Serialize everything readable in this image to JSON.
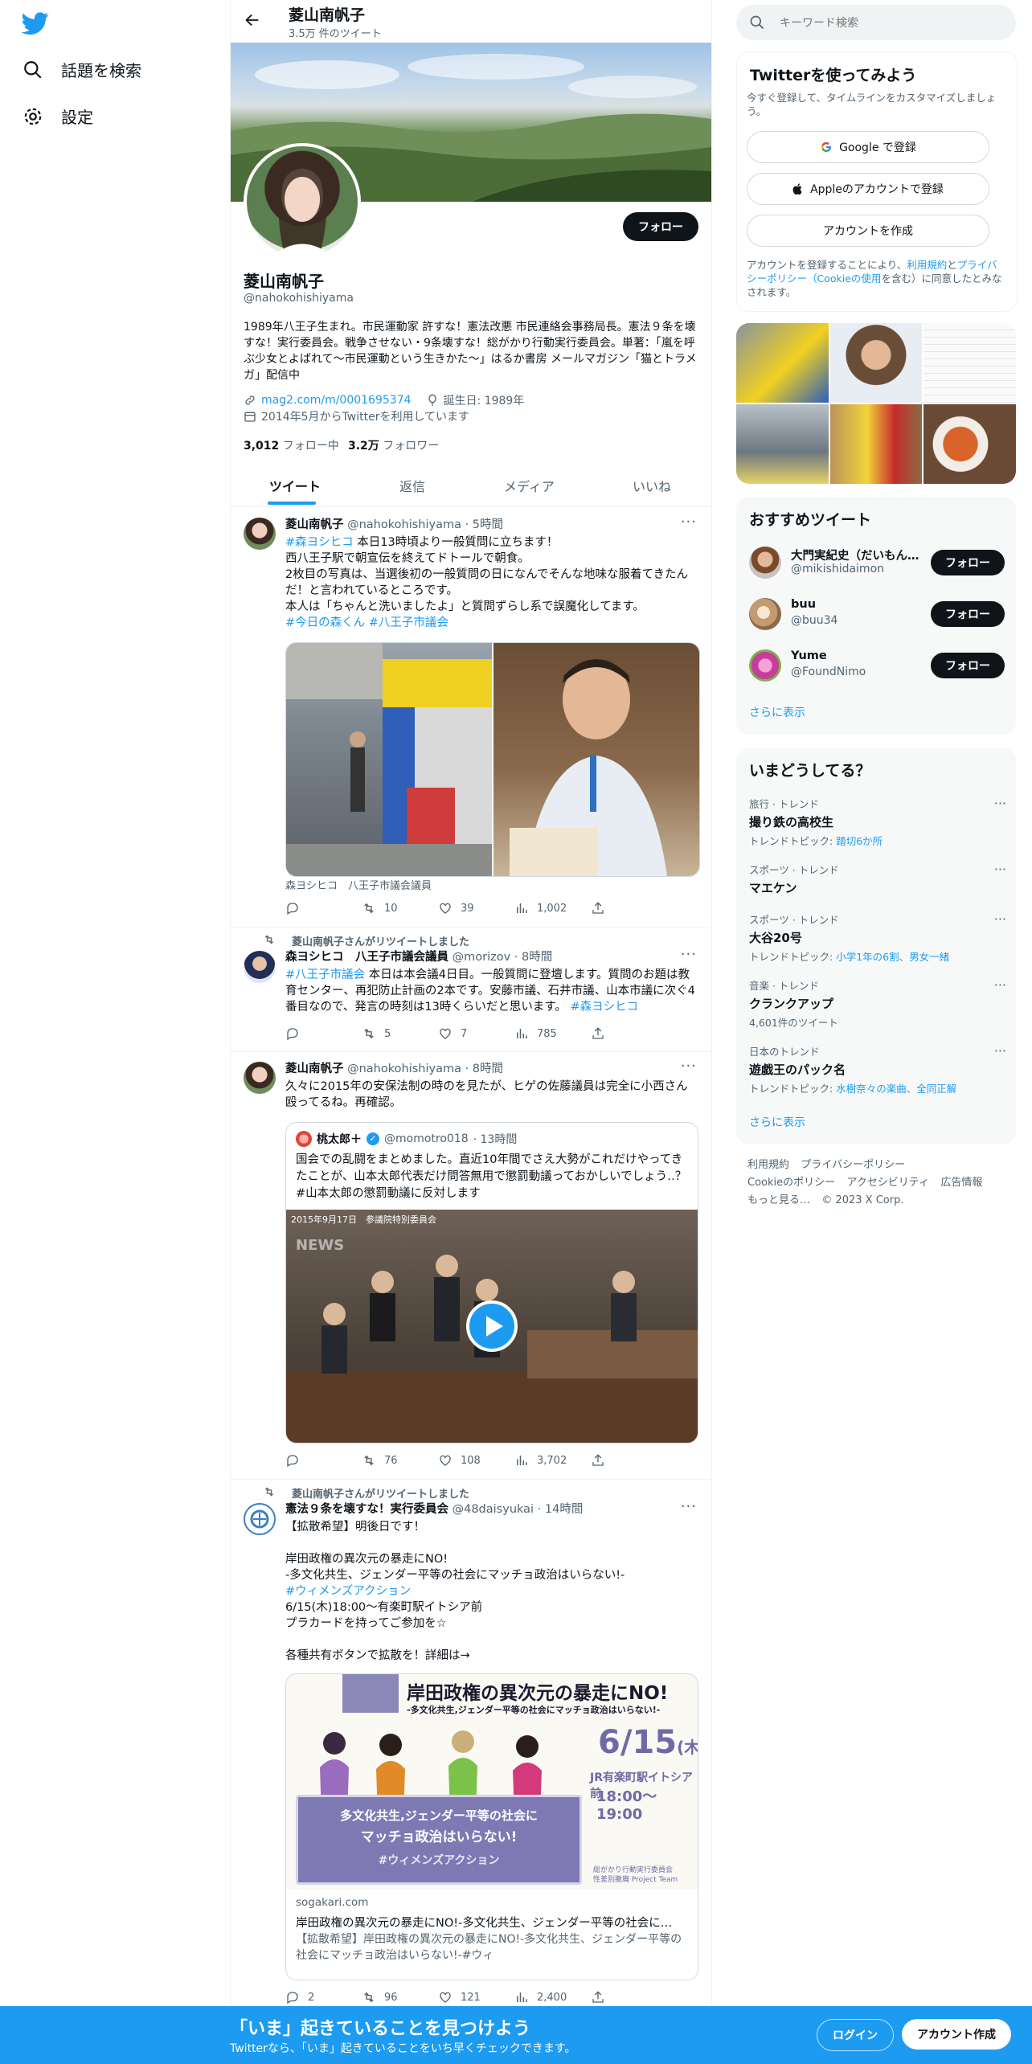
{
  "nav": {
    "explore_label": "話題を検索",
    "settings_label": "設定"
  },
  "profile": {
    "header_name": "菱山南帆子",
    "header_count": "3.5万 件のツイート",
    "name": "菱山南帆子",
    "handle": "@nahokohishiyama",
    "follow_label": "フォロー",
    "bio": "1989年八王子生まれ。市民運動家 許すな！憲法改悪 市民連絡会事務局長。憲法９条を壊すな！実行委員会。戦争させない・9条壊すな！総がかり行動実行委員会。単著：「嵐を呼ぶ少女とよばれて〜市民運動という生きかた〜」はるか書房 メールマガジン「猫とトラメガ」配信中",
    "link": "mag2.com/m/0001695374",
    "birth": "誕生日: 1989年",
    "joined": "2014年5月からTwitterを利用しています",
    "following_count": "3,012",
    "following_label": "フォロー中",
    "followers_count": "3.2万",
    "followers_label": "フォロワー"
  },
  "tabs": [
    "ツイート",
    "返信",
    "メディア",
    "いいね"
  ],
  "tweets": [
    {
      "name": "菱山南帆子",
      "handle": "@nahokohishiyama",
      "time": "· 5時間",
      "l1_tag": "#森ヨシヒコ",
      "l1_text": " 本日13時頃より一般質問に立ちます！",
      "l2": "西八王子駅で朝宣伝を終えてドトールで朝食。",
      "l3": "2枚目の写真は、当選後初の一般質問の日になんでそんな地味な服着てきたんだ！と言われているところです。",
      "l4": "本人は「ちゃんと洗いましたよ」と質問ずらし系で誤魔化してます。",
      "tags": "#今日の森くん #八王子市議会",
      "caption": "森ヨシヒコ　八王子市議会議員",
      "retweets": "10",
      "likes": "39",
      "views": "1,002"
    },
    {
      "rt_by": "菱山南帆子さんがリツイートしました",
      "name": "森ヨシヒコ　八王子市議会議員",
      "handle": "@morizov",
      "time": "· 8時間",
      "tag1": "#八王子市議会",
      "text": " 本日は本会議4日目。一般質問に登壇します。質問のお題は教育センター、再犯防止計画の2本です。安藤市議、石井市議、山本市議に次ぐ4番目なので、発言の時刻は13時くらいだと思います。",
      "tag2": "#森ヨシヒコ",
      "retweets": "5",
      "likes": "7",
      "views": "785"
    },
    {
      "name": "菱山南帆子",
      "handle": "@nahokohishiyama",
      "time": "· 8時間",
      "text": "久々に2015年の安保法制の時のを見たが、ヒゲの佐藤議員は完全に小西さん殴ってるね。再確認。",
      "quote_name": "桃太郎＋",
      "quote_handle": "@momotro018",
      "quote_time": "· 13時間",
      "quote_text": "国会での乱闘をまとめました。直近10年間でさえ大勢がこれだけやってきたことが、山本太郎代表だけ問答無用で懲罰動議っておかしいでしょう‥？ #山本太郎の懲罰動議に反対します",
      "video_stamp": "2015年9月17日　参議院特別委員会",
      "video_news": "NEWS",
      "retweets": "76",
      "likes": "108",
      "views": "3,702"
    },
    {
      "rt_by": "菱山南帆子さんがリツイートしました",
      "name": "憲法９条を壊すな！実行委員会",
      "handle": "@48daisyukai",
      "time": "· 14時間",
      "l1": "【拡散希望】明後日です！",
      "l2": "岸田政権の異次元の暴走にNO!",
      "l3": "-多文化共生、ジェンダー平等の社会にマッチョ政治はいらない!-",
      "tag": "#ウィメンズアクション",
      "l4": "6/15(木)18:00〜有楽町駅イトシア前",
      "l5": "プラカードを持ってご参加を☆",
      "l6": "各種共有ボタンで拡散を！詳細は→",
      "card_domain": "sogakari.com",
      "card_title": "岸田政権の異次元の暴走にNO!-多文化共生、ジェンダー平等の社会に…",
      "card_desc": "【拡散希望】岸田政権の異次元の暴走にNO!-多文化共生、ジェンダー平等の社会にマッチョ政治はいらない!-#ウィ",
      "flyer_title": "岸田政権の異次元の暴走にNO!",
      "flyer_sub": "-多文化共生,ジェンダー平等の社会にマッチョ政治はいらない!-",
      "flyer_date": "6/15",
      "flyer_dow": "(木)",
      "flyer_place": "JR有楽町駅イトシア前",
      "flyer_time": "18:00〜19:00",
      "flyer_banner1": "多文化共生,ジェンダー平等の社会に",
      "flyer_banner2": "マッチョ政治はいらない!",
      "flyer_banner3": "#ウィメンズアクション",
      "flyer_org1": "総がかり行動実行委員会",
      "flyer_org2": "性差別撤廃 Project Team",
      "replies": "2",
      "retweets": "96",
      "likes": "121",
      "views": "2,400"
    }
  ],
  "search": {
    "placeholder": "キーワード検索"
  },
  "signup": {
    "title": "Twitterを使ってみよう",
    "subtitle": "今すぐ登録して、タイムラインをカスタマイズしましょう。",
    "google": "Google で登録",
    "apple": "Appleのアカウントで登録",
    "create": "アカウントを作成",
    "legal_1": "アカウントを登録することにより、",
    "legal_terms": "利用規約",
    "legal_2": "と",
    "legal_privacy": "プライバシーポリシー（Cookieの使用",
    "legal_3": "を含む）に同意したとみなされます。"
  },
  "who_to_follow": {
    "title": "おすすめツイート",
    "users": [
      {
        "name": "大門実紀史（だいもん…",
        "handle": "@mikishidaimon",
        "button": "フォロー"
      },
      {
        "name": "buu",
        "handle": "@buu34",
        "button": "フォロー"
      },
      {
        "name": "Yume",
        "handle": "@FoundNimo",
        "button": "フォロー"
      }
    ],
    "more": "さらに表示"
  },
  "trends": {
    "title": "いまどうしてる？",
    "items": [
      {
        "cat": "旅行 · トレンド",
        "name": "撮り鉄の高校生",
        "sub": "トレンドトピック: ",
        "link": "踏切6か所"
      },
      {
        "cat": "スポーツ · トレンド",
        "name": "マエケン",
        "sub": "",
        "link": ""
      },
      {
        "cat": "スポーツ · トレンド",
        "name": "大谷20号",
        "sub": "トレンドトピック: ",
        "link": "小学1年の6割、男女一緒"
      },
      {
        "cat": "音楽 · トレンド",
        "name": "クランクアップ",
        "sub": "4,601件のツイート",
        "link": ""
      },
      {
        "cat": "日本のトレンド",
        "name": "遊戯王のパック名",
        "sub": "トレンドトピック: ",
        "link": "水樹奈々の楽曲、全同正解"
      }
    ],
    "more": "さらに表示"
  },
  "footer": {
    "terms": "利用規約",
    "privacy": "プライバシーポリシー",
    "cookie": "Cookieのポリシー",
    "accessibility": "アクセシビリティ",
    "ads": "広告情報",
    "more": "もっと見る…",
    "copyright": "© 2023 X Corp."
  },
  "banner": {
    "title": "「いま」起きていることを見つけよう",
    "subtitle": "Twitterなら、「いま」起きていることをいち早くチェックできます。",
    "login": "ログイン",
    "signup": "アカウント作成"
  },
  "colors": {
    "accent": "#1d9bf0",
    "text": "#0f1419",
    "muted": "#536471"
  }
}
